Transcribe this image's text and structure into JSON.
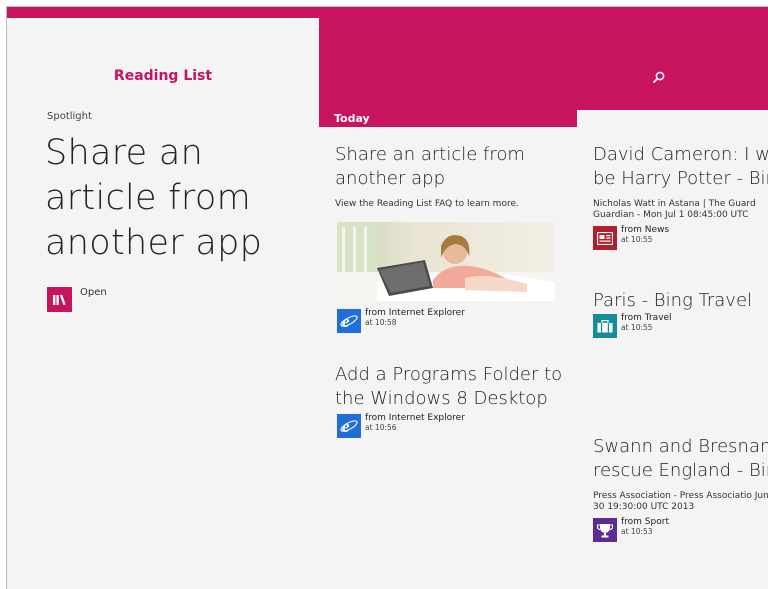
{
  "header": {
    "app_title": "Reading List",
    "search_icon": "search-icon",
    "accent_color": "#c8135f"
  },
  "spotlight": {
    "label": "Spotlight",
    "title": "Share an article from another app",
    "open_label": "Open"
  },
  "sections": {
    "today_label": "Today"
  },
  "items": [
    {
      "title": "Share an article from another app",
      "description": "View the Reading List FAQ to learn more.",
      "source": "from Internet Explorer",
      "time": "at 10:58",
      "icon": "internet-explorer-icon"
    },
    {
      "title": "Add a Programs Folder to the Windows 8 Desktop",
      "source": "from Internet Explorer",
      "time": "at 10:56",
      "icon": "internet-explorer-icon"
    },
    {
      "title": "David Cameron: I wa be Harry Potter - Bin",
      "description": "Nicholas Watt in Astana | The Guard Guardian - Mon Jul 1 08:45:00 UTC",
      "source": "from News",
      "time": "at 10:55",
      "icon": "news-icon",
      "icon_color": "#b31d2e"
    },
    {
      "title": "Paris - Bing Travel",
      "source": "from Travel",
      "time": "at 10:55",
      "icon": "travel-icon",
      "icon_color": "#178c99"
    },
    {
      "title": "Swann and Bresnan rescue England - Bin",
      "description": "Press Association - Press Associatio Jun 30 19:30:00 UTC 2013",
      "source": "from Sport",
      "time": "at 10:53",
      "icon": "sport-icon",
      "icon_color": "#5b2d91"
    }
  ]
}
